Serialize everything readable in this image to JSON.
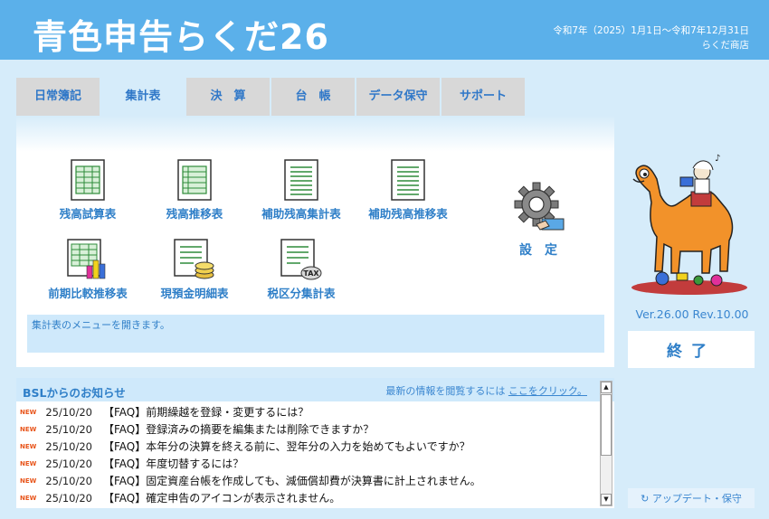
{
  "header": {
    "logo": "青色申告らくだ26",
    "period": "令和7年（2025）1月1日〜令和7年12月31日",
    "company": "らくだ商店"
  },
  "tabs": [
    "日常簿記",
    "集計表",
    "決　算",
    "台　帳",
    "データ保守",
    "サポート"
  ],
  "active_tab": "集計表",
  "menu": {
    "items": [
      "残高試算表",
      "残高推移表",
      "補助残高集計表",
      "補助残高推移表",
      "前期比較推移表",
      "現預金明細表",
      "税区分集計表"
    ],
    "settings": "設　定",
    "tax_badge": "TAX"
  },
  "status_message": "集計表のメニューを開きます。",
  "version": "Ver.26.00 Rev.10.00",
  "exit_label": "終了",
  "update_label": "↻ アップデート・保守",
  "news": {
    "title": "BSLからのお知らせ",
    "link_prefix": "最新の情報を閲覧するには",
    "link_text": "ここをクリック。",
    "new_badge": "NEW",
    "items": [
      {
        "date": "25/10/20",
        "text": "【FAQ】前期繰越を登録・変更するには？"
      },
      {
        "date": "25/10/20",
        "text": "【FAQ】登録済みの摘要を編集または削除できますか？"
      },
      {
        "date": "25/10/20",
        "text": "【FAQ】本年分の決算を終える前に、翌年分の入力を始めてもよいですか？"
      },
      {
        "date": "25/10/20",
        "text": "【FAQ】年度切替するには？"
      },
      {
        "date": "25/10/20",
        "text": "【FAQ】固定資産台帳を作成しても、減価償却費が決算書に計上されません。"
      },
      {
        "date": "25/10/20",
        "text": "【FAQ】確定申告のアイコンが表示されません。"
      }
    ]
  },
  "colors": {
    "header_bg": "#5bb0ea",
    "accent_text": "#2f7fc8",
    "new_badge": "#e8541a",
    "icon_green": "#2e8b3a"
  },
  "icons": [
    "ledger-sheet-icon",
    "chart-sheet-icon",
    "coins-icon",
    "tax-icon",
    "gear-icon",
    "camel-mascot-icon"
  ]
}
